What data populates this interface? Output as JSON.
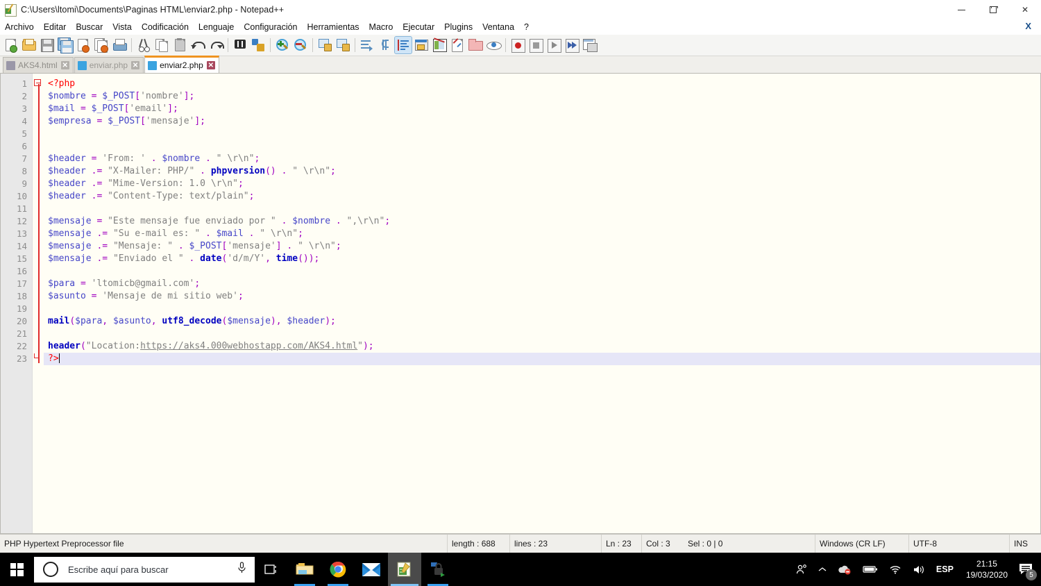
{
  "window": {
    "title": "C:\\Users\\ltomi\\Documents\\Paginas HTML\\enviar2.php - Notepad++",
    "icon": "notepadpp-icon",
    "minimize": "minimize-icon",
    "maximize": "restore-icon",
    "close": "close-icon",
    "doc_close": "X"
  },
  "menubar": {
    "items": [
      {
        "label": "Archivo"
      },
      {
        "label": "Editar"
      },
      {
        "label": "Buscar"
      },
      {
        "label": "Vista"
      },
      {
        "label": "Codificación"
      },
      {
        "label": "Lenguaje"
      },
      {
        "label": "Configuración"
      },
      {
        "label": "Herramientas"
      },
      {
        "label": "Macro"
      },
      {
        "label": "Ejecutar"
      },
      {
        "label": "Plugins"
      },
      {
        "label": "Ventana"
      },
      {
        "label": "?"
      }
    ]
  },
  "toolbar": {
    "buttons": [
      {
        "name": "new-file-icon"
      },
      {
        "name": "open-file-icon"
      },
      {
        "name": "save-icon"
      },
      {
        "name": "save-all-icon"
      },
      {
        "name": "close-file-icon"
      },
      {
        "name": "close-all-files-icon"
      },
      {
        "name": "print-icon"
      },
      {
        "name": "separator"
      },
      {
        "name": "cut-icon"
      },
      {
        "name": "copy-icon"
      },
      {
        "name": "paste-icon"
      },
      {
        "name": "undo-icon"
      },
      {
        "name": "redo-icon"
      },
      {
        "name": "separator"
      },
      {
        "name": "find-icon"
      },
      {
        "name": "replace-icon"
      },
      {
        "name": "separator"
      },
      {
        "name": "zoom-in-icon"
      },
      {
        "name": "zoom-out-icon"
      },
      {
        "name": "separator"
      },
      {
        "name": "sync-vertical-scroll-icon"
      },
      {
        "name": "sync-horizontal-scroll-icon"
      },
      {
        "name": "separator"
      },
      {
        "name": "word-wrap-icon"
      },
      {
        "name": "show-all-characters-icon"
      },
      {
        "name": "show-indent-guide-icon"
      },
      {
        "name": "user-defined-dialog-icon"
      },
      {
        "name": "document-map-icon"
      },
      {
        "name": "function-list-icon"
      },
      {
        "name": "folder-as-workspace-icon"
      },
      {
        "name": "monitoring-icon"
      },
      {
        "name": "separator"
      },
      {
        "name": "record-macro-icon"
      },
      {
        "name": "stop-recording-icon"
      },
      {
        "name": "play-macro-icon"
      },
      {
        "name": "run-macro-multiple-icon"
      },
      {
        "name": "save-macro-icon"
      }
    ]
  },
  "tabs": [
    {
      "label": "AKS4.html",
      "active": false,
      "icon_color": "#9a97a8",
      "close": "✕"
    },
    {
      "label": "enviar.php",
      "active": false,
      "icon_color": "#3aa3e0",
      "close": "✕"
    },
    {
      "label": "enviar2.php",
      "active": true,
      "icon_color": "#3aa3e0",
      "close": "✕"
    }
  ],
  "editor": {
    "line_numbers": [
      1,
      2,
      3,
      4,
      5,
      6,
      7,
      8,
      9,
      10,
      11,
      12,
      13,
      14,
      15,
      16,
      17,
      18,
      19,
      20,
      21,
      22,
      23
    ],
    "current_line": 23,
    "lines": [
      {
        "n": 1,
        "tokens": [
          {
            "t": "tag",
            "v": "<?php"
          }
        ]
      },
      {
        "n": 2,
        "tokens": [
          {
            "t": "var",
            "v": "$nombre"
          },
          {
            "t": "plain",
            "v": " "
          },
          {
            "t": "op",
            "v": "="
          },
          {
            "t": "plain",
            "v": " "
          },
          {
            "t": "var",
            "v": "$_POST"
          },
          {
            "t": "op",
            "v": "["
          },
          {
            "t": "str",
            "v": "'nombre'"
          },
          {
            "t": "op",
            "v": "];"
          }
        ]
      },
      {
        "n": 3,
        "tokens": [
          {
            "t": "var",
            "v": "$mail"
          },
          {
            "t": "plain",
            "v": " "
          },
          {
            "t": "op",
            "v": "="
          },
          {
            "t": "plain",
            "v": " "
          },
          {
            "t": "var",
            "v": "$_POST"
          },
          {
            "t": "op",
            "v": "["
          },
          {
            "t": "str",
            "v": "'email'"
          },
          {
            "t": "op",
            "v": "];"
          }
        ]
      },
      {
        "n": 4,
        "tokens": [
          {
            "t": "var",
            "v": "$empresa"
          },
          {
            "t": "plain",
            "v": " "
          },
          {
            "t": "op",
            "v": "="
          },
          {
            "t": "plain",
            "v": " "
          },
          {
            "t": "var",
            "v": "$_POST"
          },
          {
            "t": "op",
            "v": "["
          },
          {
            "t": "str",
            "v": "'mensaje'"
          },
          {
            "t": "op",
            "v": "];"
          }
        ]
      },
      {
        "n": 5,
        "tokens": []
      },
      {
        "n": 6,
        "tokens": []
      },
      {
        "n": 7,
        "tokens": [
          {
            "t": "var",
            "v": "$header"
          },
          {
            "t": "plain",
            "v": " "
          },
          {
            "t": "op",
            "v": "="
          },
          {
            "t": "plain",
            "v": " "
          },
          {
            "t": "str",
            "v": "'From: '"
          },
          {
            "t": "plain",
            "v": " "
          },
          {
            "t": "op",
            "v": "."
          },
          {
            "t": "plain",
            "v": " "
          },
          {
            "t": "var",
            "v": "$nombre"
          },
          {
            "t": "plain",
            "v": " "
          },
          {
            "t": "op",
            "v": "."
          },
          {
            "t": "plain",
            "v": " "
          },
          {
            "t": "str",
            "v": "\" \\r\\n\""
          },
          {
            "t": "op",
            "v": ";"
          }
        ]
      },
      {
        "n": 8,
        "tokens": [
          {
            "t": "var",
            "v": "$header"
          },
          {
            "t": "plain",
            "v": " "
          },
          {
            "t": "op",
            "v": ".="
          },
          {
            "t": "plain",
            "v": " "
          },
          {
            "t": "str",
            "v": "\"X-Mailer: PHP/\""
          },
          {
            "t": "plain",
            "v": " "
          },
          {
            "t": "op",
            "v": "."
          },
          {
            "t": "plain",
            "v": " "
          },
          {
            "t": "fn",
            "v": "phpversion"
          },
          {
            "t": "op",
            "v": "()"
          },
          {
            "t": "plain",
            "v": " "
          },
          {
            "t": "op",
            "v": "."
          },
          {
            "t": "plain",
            "v": " "
          },
          {
            "t": "str",
            "v": "\" \\r\\n\""
          },
          {
            "t": "op",
            "v": ";"
          }
        ]
      },
      {
        "n": 9,
        "tokens": [
          {
            "t": "var",
            "v": "$header"
          },
          {
            "t": "plain",
            "v": " "
          },
          {
            "t": "op",
            "v": ".="
          },
          {
            "t": "plain",
            "v": " "
          },
          {
            "t": "str",
            "v": "\"Mime-Version: 1.0 \\r\\n\""
          },
          {
            "t": "op",
            "v": ";"
          }
        ]
      },
      {
        "n": 10,
        "tokens": [
          {
            "t": "var",
            "v": "$header"
          },
          {
            "t": "plain",
            "v": " "
          },
          {
            "t": "op",
            "v": ".="
          },
          {
            "t": "plain",
            "v": " "
          },
          {
            "t": "str",
            "v": "\"Content-Type: text/plain\""
          },
          {
            "t": "op",
            "v": ";"
          }
        ]
      },
      {
        "n": 11,
        "tokens": []
      },
      {
        "n": 12,
        "tokens": [
          {
            "t": "var",
            "v": "$mensaje"
          },
          {
            "t": "plain",
            "v": " "
          },
          {
            "t": "op",
            "v": "="
          },
          {
            "t": "plain",
            "v": " "
          },
          {
            "t": "str",
            "v": "\"Este mensaje fue enviado por \""
          },
          {
            "t": "plain",
            "v": " "
          },
          {
            "t": "op",
            "v": "."
          },
          {
            "t": "plain",
            "v": " "
          },
          {
            "t": "var",
            "v": "$nombre"
          },
          {
            "t": "plain",
            "v": " "
          },
          {
            "t": "op",
            "v": "."
          },
          {
            "t": "plain",
            "v": " "
          },
          {
            "t": "str",
            "v": "\",\\r\\n\""
          },
          {
            "t": "op",
            "v": ";"
          }
        ]
      },
      {
        "n": 13,
        "tokens": [
          {
            "t": "var",
            "v": "$mensaje"
          },
          {
            "t": "plain",
            "v": " "
          },
          {
            "t": "op",
            "v": ".="
          },
          {
            "t": "plain",
            "v": " "
          },
          {
            "t": "str",
            "v": "\"Su e-mail es: \""
          },
          {
            "t": "plain",
            "v": " "
          },
          {
            "t": "op",
            "v": "."
          },
          {
            "t": "plain",
            "v": " "
          },
          {
            "t": "var",
            "v": "$mail"
          },
          {
            "t": "plain",
            "v": " "
          },
          {
            "t": "op",
            "v": "."
          },
          {
            "t": "plain",
            "v": " "
          },
          {
            "t": "str",
            "v": "\" \\r\\n\""
          },
          {
            "t": "op",
            "v": ";"
          }
        ]
      },
      {
        "n": 14,
        "tokens": [
          {
            "t": "var",
            "v": "$mensaje"
          },
          {
            "t": "plain",
            "v": " "
          },
          {
            "t": "op",
            "v": ".="
          },
          {
            "t": "plain",
            "v": " "
          },
          {
            "t": "str",
            "v": "\"Mensaje: \""
          },
          {
            "t": "plain",
            "v": " "
          },
          {
            "t": "op",
            "v": "."
          },
          {
            "t": "plain",
            "v": " "
          },
          {
            "t": "var",
            "v": "$_POST"
          },
          {
            "t": "op",
            "v": "["
          },
          {
            "t": "str",
            "v": "'mensaje'"
          },
          {
            "t": "op",
            "v": "]"
          },
          {
            "t": "plain",
            "v": " "
          },
          {
            "t": "op",
            "v": "."
          },
          {
            "t": "plain",
            "v": " "
          },
          {
            "t": "str",
            "v": "\" \\r\\n\""
          },
          {
            "t": "op",
            "v": ";"
          }
        ]
      },
      {
        "n": 15,
        "tokens": [
          {
            "t": "var",
            "v": "$mensaje"
          },
          {
            "t": "plain",
            "v": " "
          },
          {
            "t": "op",
            "v": ".="
          },
          {
            "t": "plain",
            "v": " "
          },
          {
            "t": "str",
            "v": "\"Enviado el \""
          },
          {
            "t": "plain",
            "v": " "
          },
          {
            "t": "op",
            "v": "."
          },
          {
            "t": "plain",
            "v": " "
          },
          {
            "t": "fn",
            "v": "date"
          },
          {
            "t": "op",
            "v": "("
          },
          {
            "t": "str",
            "v": "'d/m/Y'"
          },
          {
            "t": "op",
            "v": ","
          },
          {
            "t": "plain",
            "v": " "
          },
          {
            "t": "fn",
            "v": "time"
          },
          {
            "t": "op",
            "v": "());"
          }
        ]
      },
      {
        "n": 16,
        "tokens": []
      },
      {
        "n": 17,
        "tokens": [
          {
            "t": "var",
            "v": "$para"
          },
          {
            "t": "plain",
            "v": " "
          },
          {
            "t": "op",
            "v": "="
          },
          {
            "t": "plain",
            "v": " "
          },
          {
            "t": "str",
            "v": "'ltomicb@gmail.com'"
          },
          {
            "t": "op",
            "v": ";"
          }
        ]
      },
      {
        "n": 18,
        "tokens": [
          {
            "t": "var",
            "v": "$asunto"
          },
          {
            "t": "plain",
            "v": " "
          },
          {
            "t": "op",
            "v": "="
          },
          {
            "t": "plain",
            "v": " "
          },
          {
            "t": "str",
            "v": "'Mensaje de mi sitio web'"
          },
          {
            "t": "op",
            "v": ";"
          }
        ]
      },
      {
        "n": 19,
        "tokens": []
      },
      {
        "n": 20,
        "tokens": [
          {
            "t": "fn",
            "v": "mail"
          },
          {
            "t": "op",
            "v": "("
          },
          {
            "t": "var",
            "v": "$para"
          },
          {
            "t": "op",
            "v": ","
          },
          {
            "t": "plain",
            "v": " "
          },
          {
            "t": "var",
            "v": "$asunto"
          },
          {
            "t": "op",
            "v": ","
          },
          {
            "t": "plain",
            "v": " "
          },
          {
            "t": "fn",
            "v": "utf8_decode"
          },
          {
            "t": "op",
            "v": "("
          },
          {
            "t": "var",
            "v": "$mensaje"
          },
          {
            "t": "op",
            "v": "),"
          },
          {
            "t": "plain",
            "v": " "
          },
          {
            "t": "var",
            "v": "$header"
          },
          {
            "t": "op",
            "v": ");"
          }
        ]
      },
      {
        "n": 21,
        "tokens": []
      },
      {
        "n": 22,
        "tokens": [
          {
            "t": "fn",
            "v": "header"
          },
          {
            "t": "op",
            "v": "("
          },
          {
            "t": "str",
            "v": "\"Location:"
          },
          {
            "t": "url",
            "v": "https://aks4.000webhostapp.com/AKS4.html"
          },
          {
            "t": "str",
            "v": "\""
          },
          {
            "t": "op",
            "v": ");"
          }
        ]
      },
      {
        "n": 23,
        "tokens": [
          {
            "t": "tag",
            "v": "?>"
          },
          {
            "t": "caret",
            "v": ""
          }
        ]
      }
    ]
  },
  "statusbar": {
    "file_type": "PHP Hypertext Preprocessor file",
    "length": "length : 688",
    "lines": "lines : 23",
    "ln": "Ln : 23",
    "col": "Col : 3",
    "sel": "Sel : 0 | 0",
    "eol": "Windows (CR LF)",
    "encoding": "UTF-8",
    "insert_mode": "INS"
  },
  "taskbar": {
    "start": "windows-logo-icon",
    "search_placeholder": "Escribe aquí para buscar",
    "cortana": "cortana-circle-icon",
    "microphone": "microphone-icon",
    "apps": [
      {
        "name": "task-view-icon"
      },
      {
        "name": "file-explorer-icon"
      },
      {
        "name": "google-chrome-icon"
      },
      {
        "name": "mail-icon"
      },
      {
        "name": "notepadpp-icon"
      },
      {
        "name": "security-app-icon"
      }
    ],
    "tray": {
      "people": "people-icon",
      "show_hidden": "show-hidden-icons-chevron",
      "onedrive": "onedrive-icon",
      "battery": "battery-icon",
      "network": "wifi-icon",
      "volume": "volume-icon",
      "language": "ESP",
      "time": "21:15",
      "date": "19/03/2020",
      "notifications_icon": "action-center-icon",
      "notifications_count": "5"
    }
  }
}
